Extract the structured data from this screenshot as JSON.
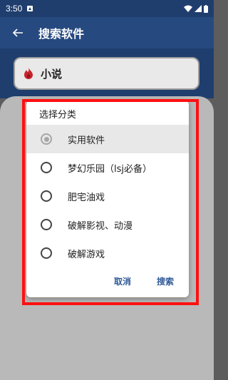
{
  "statusbar": {
    "time": "3:50"
  },
  "appbar": {
    "title": "搜索软件"
  },
  "search": {
    "value": "小说"
  },
  "dialog": {
    "title": "选择分类",
    "options": [
      {
        "label": "实用软件",
        "selected": true
      },
      {
        "label": "梦幻乐园（lsj必备）",
        "selected": false
      },
      {
        "label": "肥宅油戏",
        "selected": false
      },
      {
        "label": "破解影视、动漫",
        "selected": false
      },
      {
        "label": "破解游戏",
        "selected": false
      }
    ],
    "cancel_label": "取消",
    "search_label": "搜索"
  },
  "colors": {
    "appbar": "#26497f",
    "accent": "#2f5a98",
    "highlight": "#ff1010"
  }
}
